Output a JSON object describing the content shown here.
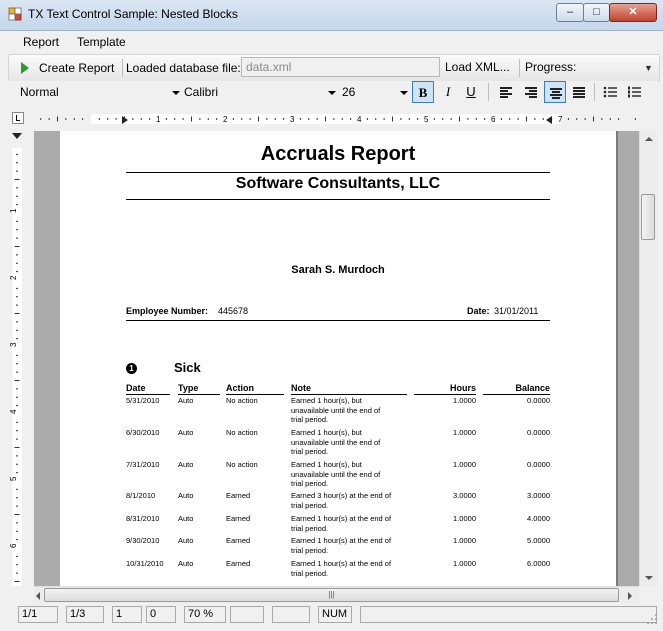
{
  "window": {
    "title": "TX Text Control Sample: Nested Blocks",
    "buttons": {
      "minimize": "–",
      "maximize": "□",
      "close": "✕"
    }
  },
  "menu": {
    "items": [
      "Report",
      "Template"
    ]
  },
  "toolbar": {
    "create_report_label": "Create Report",
    "loaded_label": "Loaded database file:",
    "db_value": "data.xml",
    "load_xml_label": "Load XML...",
    "progress_label": "Progress:"
  },
  "format_bar": {
    "style": "Normal",
    "font": "Calibri",
    "size": "26",
    "bold": "B",
    "italic": "I",
    "underline": "U",
    "active_align": "center",
    "bold_active": true
  },
  "ruler": {
    "h_labels": [
      "1",
      "2",
      "3",
      "4",
      "5",
      "6",
      "7"
    ],
    "v_labels": [
      "1",
      "2",
      "3",
      "4",
      "5",
      "6"
    ]
  },
  "document": {
    "title": "Accruals Report",
    "company": "Software Consultants, LLC",
    "employee_name": "Sarah S. Murdoch",
    "employee_number_label": "Employee Number:",
    "employee_number": "445678",
    "date_label": "Date:",
    "date": "31/01/2011",
    "section_number": "1",
    "section_title": "Sick",
    "columns": [
      "Date",
      "Type",
      "Action",
      "Note",
      "Hours",
      "Balance"
    ],
    "rows": [
      {
        "date": "5/31/2010",
        "type": "Auto",
        "action": "No action",
        "note": [
          "Earned 1 hour(s), but",
          "unavailable until the end of",
          "trial period."
        ],
        "hours": "1.0000",
        "balance": "0.0000"
      },
      {
        "date": "6/30/2010",
        "type": "Auto",
        "action": "No action",
        "note": [
          "Earned 1 hour(s), but",
          "unavailable until the end of",
          "trial period."
        ],
        "hours": "1.0000",
        "balance": "0.0000"
      },
      {
        "date": "7/31/2010",
        "type": "Auto",
        "action": "No action",
        "note": [
          "Earned 1 hour(s), but",
          "unavailable until the end of",
          "trial period."
        ],
        "hours": "1.0000",
        "balance": "0.0000"
      },
      {
        "date": "8/1/2010",
        "type": "Auto",
        "action": "Earned",
        "note": [
          "Earned 3 hour(s) at the end of",
          "trial period."
        ],
        "hours": "3.0000",
        "balance": "3.0000"
      },
      {
        "date": "8/31/2010",
        "type": "Auto",
        "action": "Earned",
        "note": [
          "Earned 1 hour(s) at the end of",
          "trial period."
        ],
        "hours": "1.0000",
        "balance": "4.0000"
      },
      {
        "date": "9/30/2010",
        "type": "Auto",
        "action": "Earned",
        "note": [
          "Earned 1 hour(s) at the end of",
          "trial period."
        ],
        "hours": "1.0000",
        "balance": "5.0000"
      },
      {
        "date": "10/31/2010",
        "type": "Auto",
        "action": "Earned",
        "note": [
          "Earned 1 hour(s) at the end of",
          "trial period."
        ],
        "hours": "1.0000",
        "balance": "6.0000"
      }
    ]
  },
  "scroll": {
    "grip": "|||"
  },
  "status": {
    "page": "1/1",
    "section": "1/3",
    "line": "1",
    "column": "0",
    "zoom": "70 %",
    "field6": "",
    "field7": "",
    "num": "NUM",
    "field9": ""
  },
  "colors": {
    "accent": "#3d7bbf",
    "page": "#ffffff",
    "workspace": "#ababab",
    "play": "#2e9b2e"
  }
}
